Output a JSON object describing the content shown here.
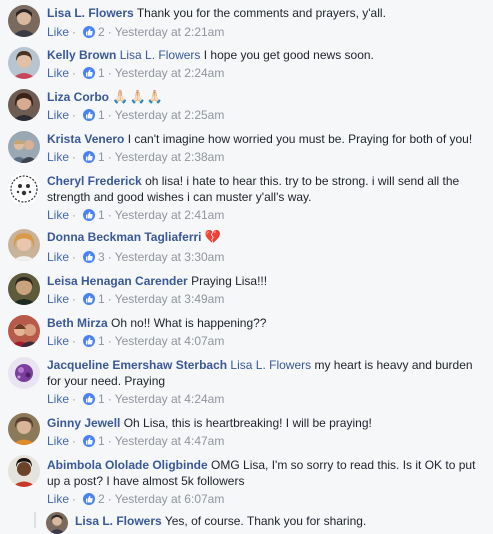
{
  "colors": {
    "link": "#385898",
    "meta": "#90949c",
    "like_blue": "#4a82f5"
  },
  "comments": [
    {
      "author": "Lisa L. Flowers",
      "mention": "",
      "text": "Thank you for the comments and prayers, y'all.",
      "like_label": "Like",
      "reaction_icon": "like-reaction-icon",
      "reactions": "2",
      "sep": "·",
      "time": "Yesterday at 2:21am"
    },
    {
      "author": "Kelly Brown",
      "mention": "Lisa L. Flowers",
      "text": "I hope you get good news soon.",
      "like_label": "Like",
      "reaction_icon": "like-reaction-icon",
      "reactions": "1",
      "sep": "·",
      "time": "Yesterday at 2:24am"
    },
    {
      "author": "Liza Corbo",
      "mention": "",
      "text": "🙏🏻🙏🏻🙏🏻",
      "like_label": "Like",
      "reaction_icon": "like-reaction-icon",
      "reactions": "1",
      "sep": "·",
      "time": "Yesterday at 2:25am"
    },
    {
      "author": "Krista Venero",
      "mention": "",
      "text": "I can't imagine how worried you must be. Praying for both of you!",
      "like_label": "Like",
      "reaction_icon": "like-reaction-icon",
      "reactions": "1",
      "sep": "·",
      "time": "Yesterday at 2:38am"
    },
    {
      "author": "Cheryl Frederick",
      "mention": "",
      "text": "oh lisa! i hate to hear this. try to be strong. i will send all the strength and good wishes i can muster y'all's way.",
      "like_label": "Like",
      "reaction_icon": "like-reaction-icon",
      "reactions": "1",
      "sep": "·",
      "time": "Yesterday at 2:41am"
    },
    {
      "author": "Donna Beckman Tagliaferri",
      "mention": "",
      "text": "💔",
      "like_label": "Like",
      "reaction_icon": "like-reaction-icon",
      "reactions": "3",
      "sep": "·",
      "time": "Yesterday at 3:30am"
    },
    {
      "author": "Leisa Henagan Carender",
      "mention": "",
      "text": "Praying Lisa!!!",
      "like_label": "Like",
      "reaction_icon": "like-reaction-icon",
      "reactions": "1",
      "sep": "·",
      "time": "Yesterday at 3:49am"
    },
    {
      "author": "Beth Mirza",
      "mention": "",
      "text": "Oh no!! What is happening??",
      "like_label": "Like",
      "reaction_icon": "like-reaction-icon",
      "reactions": "1",
      "sep": "·",
      "time": "Yesterday at 4:07am"
    },
    {
      "author": "Jacqueline Emershaw Sterbach",
      "mention": "Lisa L. Flowers",
      "text": "my heart is heavy and burden for your need. Praying",
      "like_label": "Like",
      "reaction_icon": "like-reaction-icon",
      "reactions": "1",
      "sep": "·",
      "time": "Yesterday at 4:24am"
    },
    {
      "author": "Ginny Jewell",
      "mention": "",
      "text": "Oh Lisa, this is heartbreaking! I will be praying!",
      "like_label": "Like",
      "reaction_icon": "like-reaction-icon",
      "reactions": "1",
      "sep": "·",
      "time": "Yesterday at 4:47am"
    },
    {
      "author": "Abimbola Ololade Oligbinde",
      "mention": "",
      "text": "OMG Lisa, I'm so sorry to read this. Is it OK to put up a post? I have almost 5k followers",
      "like_label": "Like",
      "reaction_icon": "like-reaction-icon",
      "reactions": "2",
      "sep": "·",
      "time": "Yesterday at 6:07am"
    }
  ],
  "reply": {
    "author": "Lisa L. Flowers",
    "text": "Yes, of course. Thank you for sharing."
  }
}
